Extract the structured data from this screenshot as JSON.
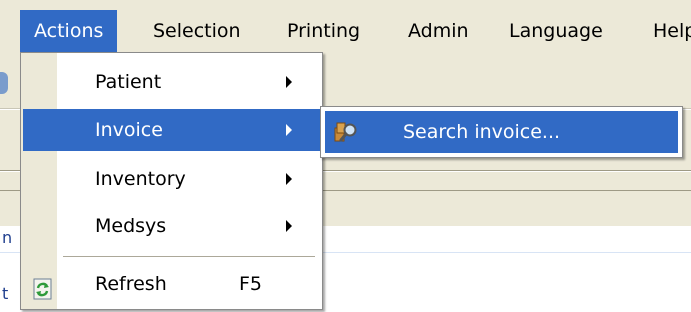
{
  "menubar": {
    "items": [
      {
        "label": "Actions",
        "active": true
      },
      {
        "label": "Selection",
        "active": false
      },
      {
        "label": "Printing",
        "active": false
      },
      {
        "label": "Admin",
        "active": false
      },
      {
        "label": "Language",
        "active": false
      },
      {
        "label": "Help",
        "active": false
      }
    ]
  },
  "actions_menu": {
    "items": [
      {
        "label": "Patient",
        "has_submenu": true
      },
      {
        "label": "Invoice",
        "has_submenu": true,
        "highlighted": true
      },
      {
        "label": "Inventory",
        "has_submenu": true
      },
      {
        "label": "Medsys",
        "has_submenu": true
      },
      {
        "label": "Refresh",
        "shortcut": "F5",
        "icon": "refresh-icon"
      }
    ]
  },
  "invoice_submenu": {
    "items": [
      {
        "label": "Search invoice...",
        "icon": "search-invoice-icon",
        "highlighted": true
      }
    ]
  },
  "background": {
    "fragment_1": "n",
    "fragment_2": "t"
  },
  "colors": {
    "menu_background": "#ece9d8",
    "highlight": "#316ac5",
    "highlight_text": "#ffffff"
  }
}
